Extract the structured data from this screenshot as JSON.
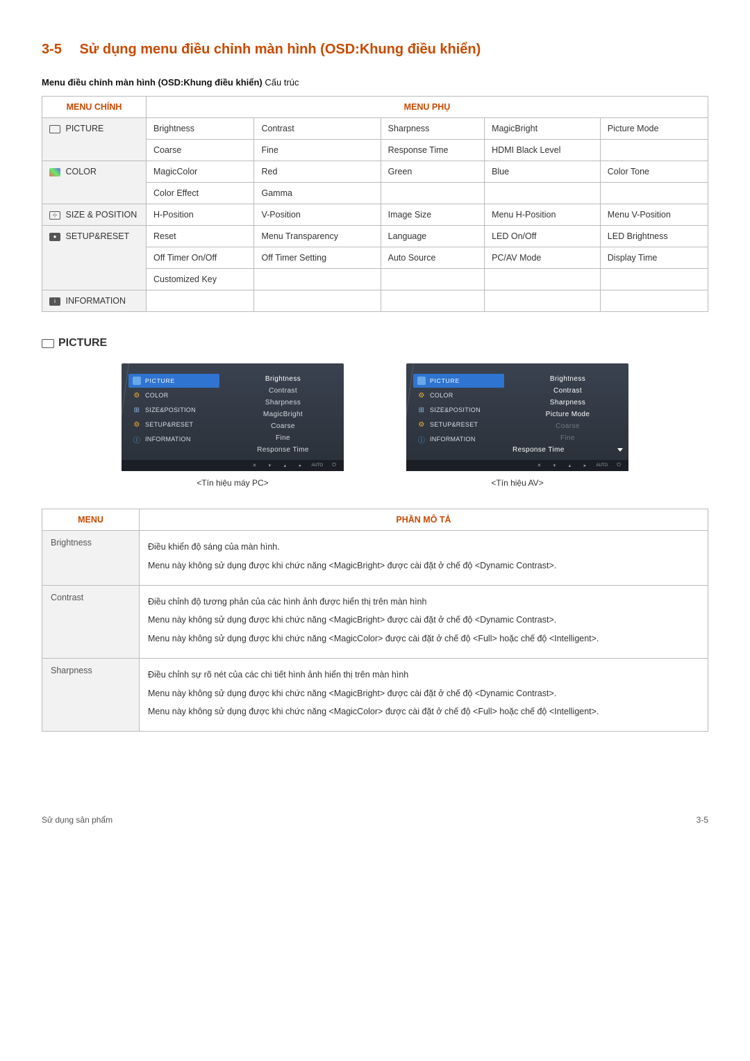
{
  "heading": {
    "num": "3-5",
    "title": "Sử dụng menu điều chỉnh màn hình (OSD:Khung điều khiển)"
  },
  "subheading": {
    "bold": "Menu điều chỉnh màn hình (OSD:Khung điều khiển)",
    "rest": " Cấu trúc"
  },
  "table1": {
    "header_main": "MENU CHÍNH",
    "header_sub": "MENU PHỤ",
    "rows": [
      {
        "main": "PICTURE",
        "cells": [
          "Brightness",
          "Contrast",
          "Sharpness",
          "MagicBright",
          "Picture Mode"
        ]
      },
      {
        "main": "",
        "cells": [
          "Coarse",
          "Fine",
          "Response Time",
          "HDMI Black Level",
          ""
        ]
      },
      {
        "main": "COLOR",
        "cells": [
          "MagicColor",
          "Red",
          "Green",
          "Blue",
          "Color Tone"
        ]
      },
      {
        "main": "",
        "cells": [
          "Color Effect",
          "Gamma",
          "",
          "",
          ""
        ]
      },
      {
        "main": "SIZE & POSITION",
        "cells": [
          "H-Position",
          "V-Position",
          "Image Size",
          "Menu H-Position",
          "Menu V-Position"
        ]
      },
      {
        "main": "SETUP&RESET",
        "cells": [
          "Reset",
          "Menu Transparency",
          "Language",
          "LED On/Off",
          "LED Brightness"
        ]
      },
      {
        "main": "",
        "cells": [
          "Off Timer On/Off",
          "Off Timer Setting",
          "Auto Source",
          "PC/AV Mode",
          "Display Time"
        ]
      },
      {
        "main": "",
        "cells": [
          "Customized Key",
          "",
          "",
          "",
          ""
        ]
      },
      {
        "main": "INFORMATION",
        "cells": [
          "",
          "",
          "",
          "",
          ""
        ]
      }
    ]
  },
  "picture_heading": "PICTURE",
  "osd": {
    "left_items": [
      "PICTURE",
      "COLOR",
      "SIZE&POSITION",
      "SETUP&RESET",
      "INFORMATION"
    ],
    "pc": {
      "right": [
        "Brightness",
        "Contrast",
        "Sharpness",
        "MagicBright",
        "Coarse",
        "Fine",
        "Response Time"
      ],
      "caption": "<Tín hiệu máy PC>"
    },
    "av": {
      "right": [
        {
          "t": "Brightness",
          "c": "bright"
        },
        {
          "t": "Contrast",
          "c": "bright"
        },
        {
          "t": "Sharpness",
          "c": "bright"
        },
        {
          "t": "Picture Mode",
          "c": "bright"
        },
        {
          "t": "Coarse",
          "c": "dim"
        },
        {
          "t": "Fine",
          "c": "dim"
        },
        {
          "t": "Response Time",
          "c": "bright"
        }
      ],
      "caption": "<Tín hiệu AV>"
    },
    "footer_icons": [
      "✕",
      "▾",
      "▴",
      "▸",
      "AUTO",
      "⏻"
    ]
  },
  "table2": {
    "header_menu": "MENU",
    "header_desc": "PHẦN MÔ TẢ",
    "rows": [
      {
        "menu": "Brightness",
        "paras": [
          "Điều khiển độ sáng của màn hình.",
          "Menu này không sử dụng được khi chức năng <MagicBright> được cài đặt ở chế độ <Dynamic Contrast>."
        ]
      },
      {
        "menu": "Contrast",
        "paras": [
          "Điều chỉnh độ tương phản của các hình ảnh được hiển thị trên màn hình",
          "Menu này không sử dụng được khi chức năng <MagicBright> được cài đặt ở chế độ <Dynamic Contrast>.",
          "Menu này không sử dụng được khi chức năng <MagicColor> được cài đặt ở chế độ <Full> hoặc chế độ <Intelligent>."
        ]
      },
      {
        "menu": "Sharpness",
        "paras": [
          "Điều chỉnh sự rõ nét của các chi tiết hình ảnh hiển thị trên màn hình",
          "Menu này không sử dụng được khi chức năng <MagicBright> được cài đặt ở chế độ <Dynamic Contrast>.",
          "Menu này không sử dụng được khi chức năng <MagicColor> được cài đặt ở chế độ <Full> hoặc chế độ <Intelligent>."
        ]
      }
    ]
  },
  "footer": {
    "left": "Sử dụng sản phẩm",
    "right": "3-5"
  }
}
